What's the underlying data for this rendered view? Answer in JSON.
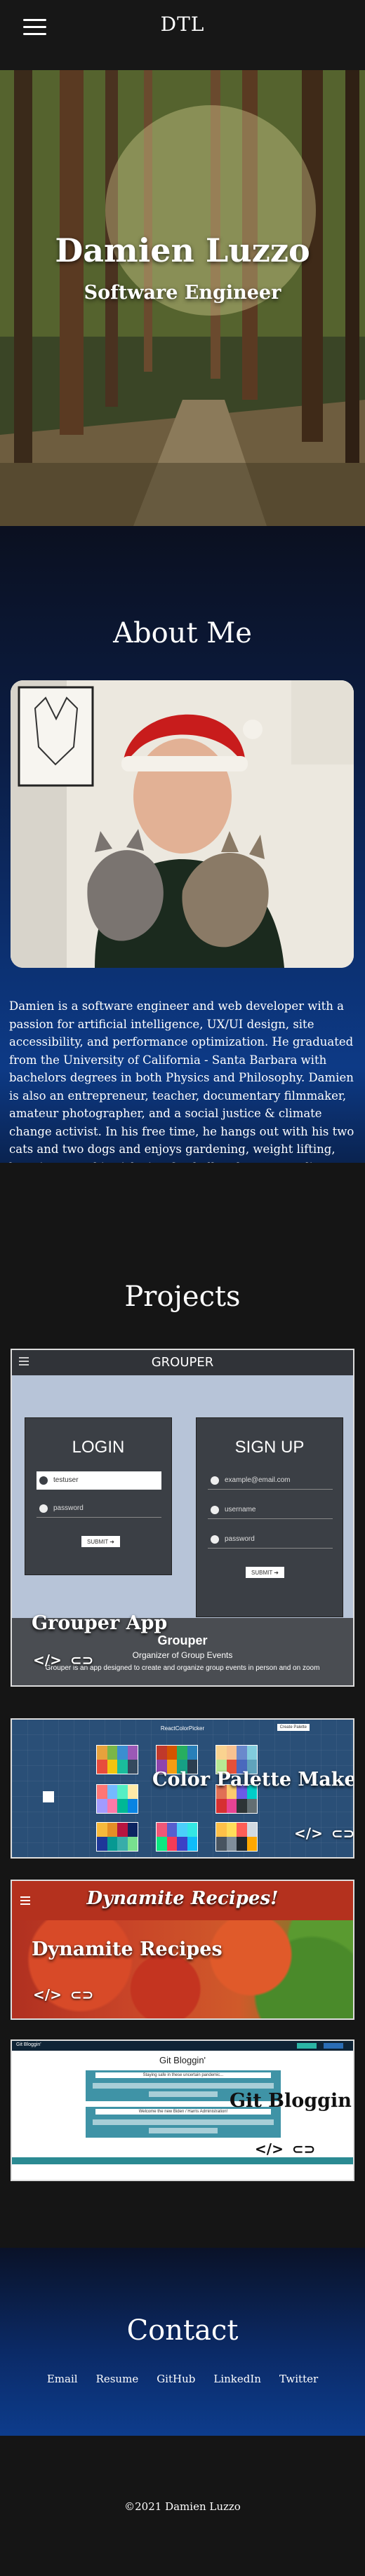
{
  "header": {
    "brand": "DTL",
    "menu_icon": "hamburger-menu-icon"
  },
  "hero": {
    "name": "Damien Luzzo",
    "role": "Software Engineer"
  },
  "about": {
    "title": "About Me",
    "photo_alt": "Damien holding two cats",
    "bio": "Damien is a software engineer and web developer with a passion for artificial intelligence, UX/UI design, site accessibility, and performance optimization. He graduated from the University of California - Santa Barbara with bachelors degrees in both Physics and Philosophy. Damien is also an entrepreneur, teacher, documentary filmmaker, amateur photographer, and a social justice & climate change activist. In his free time, he hangs out with his two cats and two dogs and enjoys gardening, weight lifting, learning, watching/playing football and soccer, coding, and making the world a better place."
  },
  "projects": {
    "title": "Projects",
    "items": [
      {
        "label": "Grouper App",
        "screenshot": {
          "logo": "GROUPER",
          "login_title": "LOGIN",
          "login_user": "testuser",
          "login_pass": "password",
          "login_button": "SUBMIT",
          "signup_title": "SIGN UP",
          "signup_email": "example@email.com",
          "signup_user": "username",
          "signup_pass": "password",
          "signup_button": "SUBMIT",
          "footer_title": "Grouper",
          "footer_sub": "Organizer of Group Events",
          "footer_desc": "Grouper is an app designed to create and organize group events in person and on zoom"
        }
      },
      {
        "label": "Color Palette Maker",
        "screenshot": {
          "app_title": "ReactColorPicker",
          "button": "Create Palette"
        }
      },
      {
        "label": "Dynamite Recipes",
        "screenshot": {
          "header_title": "Dynamite Recipes!"
        }
      },
      {
        "label": "Git Bloggin",
        "screenshot": {
          "title": "Git Bloggin'",
          "brand": "Git Bloggin'",
          "post_1": "Staying safe in these uncertain pandemic...",
          "post_2": "Welcome the new Biden / Harris Administration!"
        }
      }
    ],
    "icons": {
      "code": "code-icon",
      "link": "link-icon"
    }
  },
  "contact": {
    "title": "Contact",
    "links": [
      "Email",
      "Resume",
      "GitHub",
      "LinkedIn",
      "Twitter"
    ]
  },
  "footer": {
    "copyright": "©2021 Damien Luzzo"
  }
}
